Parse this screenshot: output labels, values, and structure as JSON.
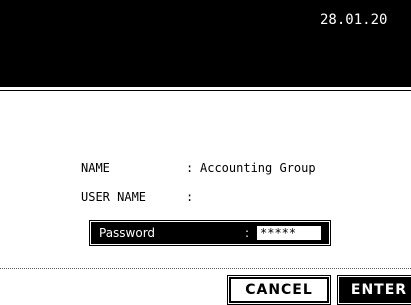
{
  "header": {
    "datetime": "28.01.20"
  },
  "account": {
    "name_label": "NAME",
    "name_sep": ":",
    "name_value": "Accounting Group",
    "user_label": "USER NAME",
    "user_sep": ":",
    "user_value": ""
  },
  "password": {
    "label": "Password",
    "sep": ":",
    "value": "*****"
  },
  "buttons": {
    "cancel": "CANCEL",
    "enter": "ENTER"
  },
  "colors": {
    "background": "#ffffff",
    "header_background": "#000000",
    "text": "#000000"
  }
}
